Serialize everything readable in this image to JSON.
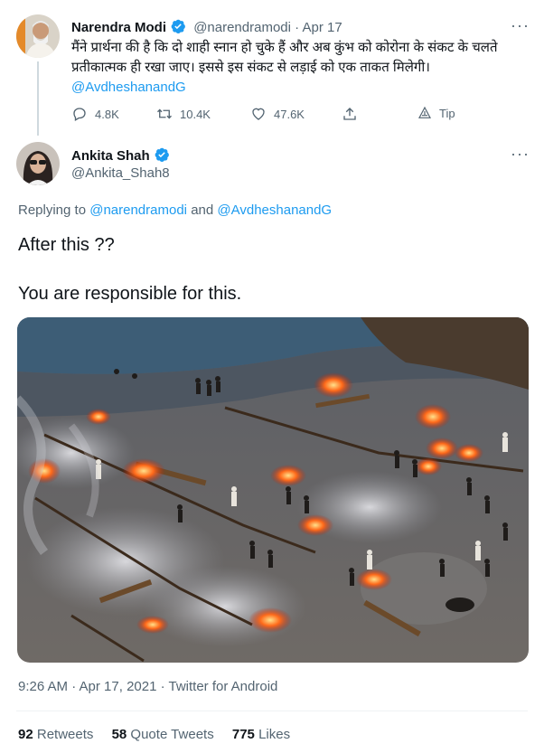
{
  "quoted_tweet": {
    "author_name": "Narendra Modi",
    "handle": "@narendramodi",
    "separator": "·",
    "date": "Apr 17",
    "text_line1": "मैंने प्रार्थना की है कि दो शाही स्नान हो चुके हैं और अब कुंभ को कोरोना के संकट के चलते",
    "text_line2": "प्रतीकात्मक ही रखा जाए। इससे इस संकट से लड़ाई को एक ताकत मिलेगी।",
    "mention": "@AvdheshanandG",
    "replies": "4.8K",
    "retweets": "10.4K",
    "likes": "47.6K",
    "tip_label": "Tip"
  },
  "main_tweet": {
    "author_name": "Ankita Shah",
    "handle": "@Ankita_Shah8",
    "replying_to_label": "Replying to",
    "reply_mention_1": "@narendramodi",
    "reply_and": "and",
    "reply_mention_2": "@AvdheshanandG",
    "line1": "After this ??",
    "line2": "You are responsible for this.",
    "timestamp": "9:26 AM · Apr 17, 2021 · Twitter for Android",
    "retweet_count": "92",
    "retweet_label": "Retweets",
    "quote_count": "58",
    "quote_label": "Quote Tweets",
    "like_count": "775",
    "like_label": "Likes"
  },
  "colors": {
    "accent": "#1d9bf0",
    "muted": "#536471",
    "text": "#0f1419"
  },
  "icons": [
    "verified-badge-icon",
    "more-icon",
    "reply-icon",
    "retweet-icon",
    "like-icon",
    "share-icon",
    "tip-icon"
  ]
}
